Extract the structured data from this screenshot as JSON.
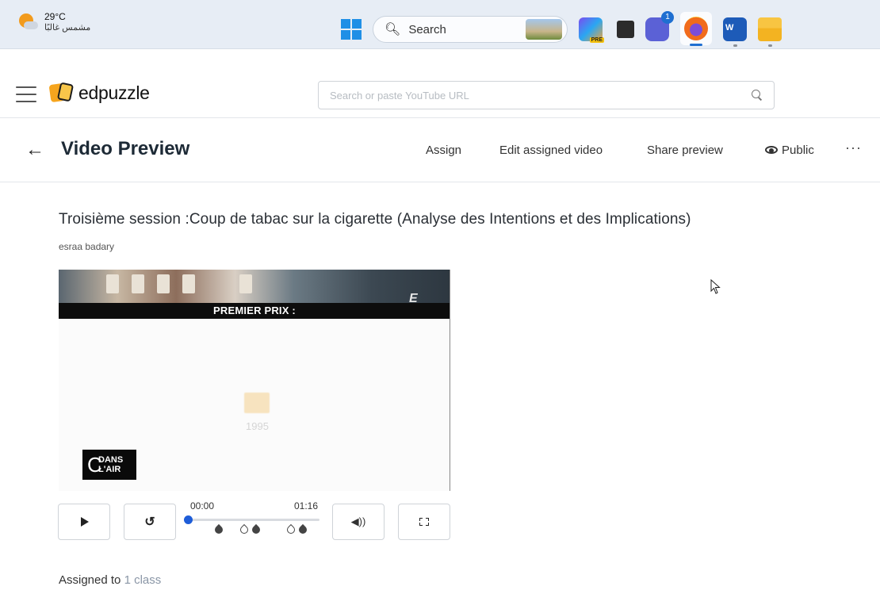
{
  "taskbar": {
    "weather_temp": "29°C",
    "weather_desc": "مشمس غالبًا",
    "search_label": "Search",
    "teams_badge": "1",
    "copilot_badge": "PRE",
    "word_letter": "W",
    "apps": [
      "windows-start-icon",
      "copilot-icon",
      "dark-app-icon",
      "teams-icon",
      "firefox-icon",
      "word-icon",
      "file-explorer-icon"
    ]
  },
  "header": {
    "logo_text": "edpuzzle",
    "search_placeholder": "Search or paste YouTube URL"
  },
  "subheader": {
    "back_icon": "←",
    "title": "Video Preview",
    "actions": {
      "assign": "Assign",
      "edit": "Edit assigned video",
      "share": "Share preview",
      "public": "Public"
    },
    "more": "···"
  },
  "video": {
    "title": "Troisième session :Coup de tabac sur la cigarette (Analyse des Intentions et des Implications)",
    "author": "esraa badary",
    "banner_text": "PREMIER PRIX :",
    "channel_logo": "E",
    "year_text": "1995",
    "watermark_c": "C",
    "watermark_text": "DANS L'AIR"
  },
  "controls": {
    "time_current": "00:00",
    "time_total": "01:16",
    "progress": 0,
    "replay_icon": "↺",
    "volume_icon": "◀))"
  },
  "assigned": {
    "prefix": "Assigned to",
    "link": "1 class"
  },
  "colors": {
    "accent_blue": "#1e5dd8",
    "title_dark": "#1d2a36",
    "logo_orange": "#f6a51e"
  }
}
